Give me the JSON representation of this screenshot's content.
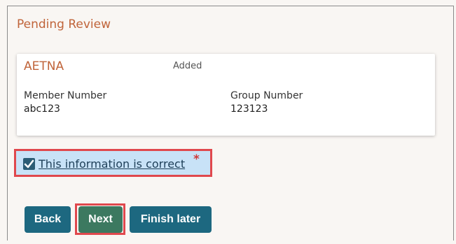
{
  "review": {
    "title": "Pending Review",
    "card": {
      "insurer": "AETNA",
      "status": "Added",
      "member_label": "Member Number",
      "member_value": "abc123",
      "group_label": "Group Number",
      "group_value": "123123"
    },
    "confirm": {
      "label": "This information is correct",
      "checked": true,
      "required_mark": "*"
    }
  },
  "actions": {
    "back": "Back",
    "next": "Next",
    "finish_later": "Finish later"
  },
  "colors": {
    "accent": "#c0643a",
    "primary_button": "#1d6880",
    "next_button": "#3c7960",
    "highlight_border": "#e0484d",
    "confirm_bg": "#c8e2f7"
  }
}
